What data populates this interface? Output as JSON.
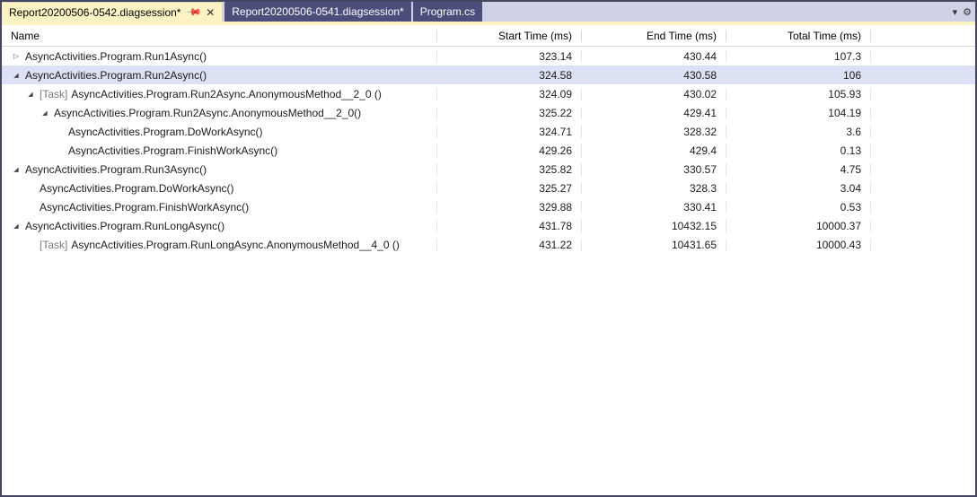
{
  "tabs": [
    {
      "label": "Report20200506-0542.diagsession*",
      "active": true,
      "pinned": true,
      "closable": true
    },
    {
      "label": "Report20200506-0541.diagsession*",
      "active": false
    },
    {
      "label": "Program.cs",
      "active": false
    }
  ],
  "columns": {
    "name": "Name",
    "start": "Start Time (ms)",
    "end": "End Time (ms)",
    "total": "Total Time (ms)"
  },
  "task_prefix": "[Task]",
  "rows": [
    {
      "depth": 0,
      "expander": "collapsed",
      "task": false,
      "name": "AsyncActivities.Program.Run1Async()",
      "start": "323.14",
      "end": "430.44",
      "total": "107.3",
      "selected": false
    },
    {
      "depth": 0,
      "expander": "expanded",
      "task": false,
      "name": "AsyncActivities.Program.Run2Async()",
      "start": "324.58",
      "end": "430.58",
      "total": "106",
      "selected": true
    },
    {
      "depth": 1,
      "expander": "expanded",
      "task": true,
      "name": "AsyncActivities.Program.Run2Async.AnonymousMethod__2_0 ()",
      "start": "324.09",
      "end": "430.02",
      "total": "105.93",
      "selected": false
    },
    {
      "depth": 2,
      "expander": "expanded",
      "task": false,
      "name": "AsyncActivities.Program.Run2Async.AnonymousMethod__2_0()",
      "start": "325.22",
      "end": "429.41",
      "total": "104.19",
      "selected": false
    },
    {
      "depth": 3,
      "expander": "none",
      "task": false,
      "name": "AsyncActivities.Program.DoWorkAsync()",
      "start": "324.71",
      "end": "328.32",
      "total": "3.6",
      "selected": false
    },
    {
      "depth": 3,
      "expander": "none",
      "task": false,
      "name": "AsyncActivities.Program.FinishWorkAsync()",
      "start": "429.26",
      "end": "429.4",
      "total": "0.13",
      "selected": false
    },
    {
      "depth": 0,
      "expander": "expanded",
      "task": false,
      "name": "AsyncActivities.Program.Run3Async()",
      "start": "325.82",
      "end": "330.57",
      "total": "4.75",
      "selected": false
    },
    {
      "depth": 1,
      "expander": "none",
      "task": false,
      "name": "AsyncActivities.Program.DoWorkAsync()",
      "start": "325.27",
      "end": "328.3",
      "total": "3.04",
      "selected": false
    },
    {
      "depth": 1,
      "expander": "none",
      "task": false,
      "name": "AsyncActivities.Program.FinishWorkAsync()",
      "start": "329.88",
      "end": "330.41",
      "total": "0.53",
      "selected": false
    },
    {
      "depth": 0,
      "expander": "expanded",
      "task": false,
      "name": "AsyncActivities.Program.RunLongAsync()",
      "start": "431.78",
      "end": "10432.15",
      "total": "10000.37",
      "selected": false
    },
    {
      "depth": 1,
      "expander": "none",
      "task": true,
      "name": "AsyncActivities.Program.RunLongAsync.AnonymousMethod__4_0 ()",
      "start": "431.22",
      "end": "10431.65",
      "total": "10000.43",
      "selected": false
    }
  ]
}
